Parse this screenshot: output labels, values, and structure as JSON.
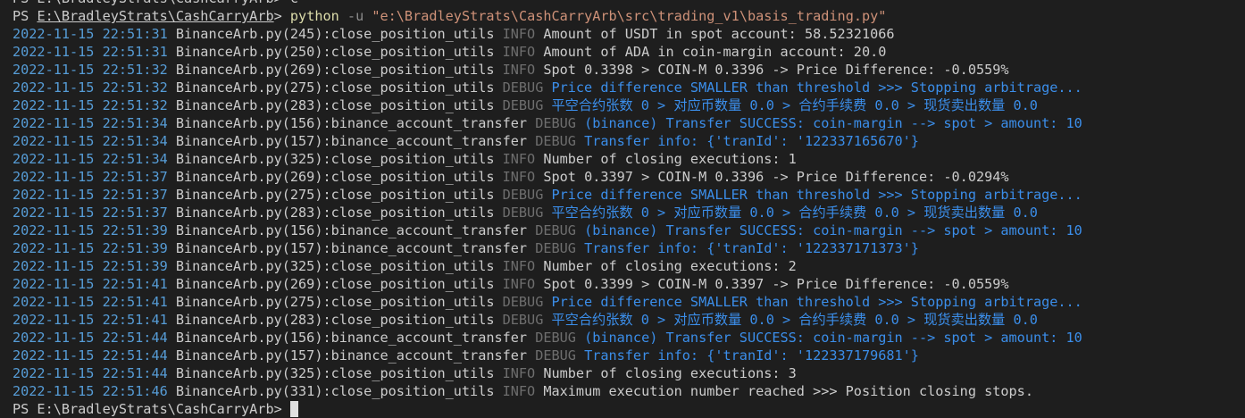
{
  "terminal": {
    "prev_line": "PS E:\\BradleyStrats\\CashCarryArb> c",
    "command": {
      "ps": "PS ",
      "path": "E:\\BradleyStrats\\CashCarryArb",
      "gt": "> ",
      "cmd": "python",
      "flag": " -u ",
      "arg": "\"e:\\BradleyStrats\\CashCarryArb\\src\\trading_v1\\basis_trading.py\""
    },
    "logs": [
      {
        "ts": "2022-11-15 22:51:31",
        "src": " BinanceArb.py(245):close_position_utils ",
        "level": "INFO",
        "msg": " Amount of USDT in spot account: 58.52321066"
      },
      {
        "ts": "2022-11-15 22:51:31",
        "src": " BinanceArb.py(250):close_position_utils ",
        "level": "INFO",
        "msg": " Amount of ADA in coin-margin account: 20.0"
      },
      {
        "ts": "2022-11-15 22:51:32",
        "src": " BinanceArb.py(269):close_position_utils ",
        "level": "INFO",
        "msg": " Spot 0.3398 > COIN-M 0.3396 -> Price Difference: -0.0559%"
      },
      {
        "ts": "2022-11-15 22:51:32",
        "src": " BinanceArb.py(275):close_position_utils ",
        "level": "DEBUG",
        "msg": " Price difference SMALLER than threshold >>> Stopping arbitrage..."
      },
      {
        "ts": "2022-11-15 22:51:32",
        "src": " BinanceArb.py(283):close_position_utils ",
        "level": "DEBUG",
        "msg": " 平空合约张数 0 > 对应币数量 0.0 > 合约手续费 0.0 > 现货卖出数量 0.0"
      },
      {
        "ts": "2022-11-15 22:51:34",
        "src": " BinanceArb.py(156):binance_account_transfer ",
        "level": "DEBUG",
        "msg": " (binance) Transfer SUCCESS: coin-margin --> spot > amount: 10"
      },
      {
        "ts": "2022-11-15 22:51:34",
        "src": " BinanceArb.py(157):binance_account_transfer ",
        "level": "DEBUG",
        "msg": " Transfer info: {'tranId': '122337165670'}"
      },
      {
        "ts": "2022-11-15 22:51:34",
        "src": " BinanceArb.py(325):close_position_utils ",
        "level": "INFO",
        "msg": " Number of closing executions: 1"
      },
      {
        "ts": "2022-11-15 22:51:37",
        "src": " BinanceArb.py(269):close_position_utils ",
        "level": "INFO",
        "msg": " Spot 0.3397 > COIN-M 0.3396 -> Price Difference: -0.0294%"
      },
      {
        "ts": "2022-11-15 22:51:37",
        "src": " BinanceArb.py(275):close_position_utils ",
        "level": "DEBUG",
        "msg": " Price difference SMALLER than threshold >>> Stopping arbitrage..."
      },
      {
        "ts": "2022-11-15 22:51:37",
        "src": " BinanceArb.py(283):close_position_utils ",
        "level": "DEBUG",
        "msg": " 平空合约张数 0 > 对应币数量 0.0 > 合约手续费 0.0 > 现货卖出数量 0.0"
      },
      {
        "ts": "2022-11-15 22:51:39",
        "src": " BinanceArb.py(156):binance_account_transfer ",
        "level": "DEBUG",
        "msg": " (binance) Transfer SUCCESS: coin-margin --> spot > amount: 10"
      },
      {
        "ts": "2022-11-15 22:51:39",
        "src": " BinanceArb.py(157):binance_account_transfer ",
        "level": "DEBUG",
        "msg": " Transfer info: {'tranId': '122337171373'}"
      },
      {
        "ts": "2022-11-15 22:51:39",
        "src": " BinanceArb.py(325):close_position_utils ",
        "level": "INFO",
        "msg": " Number of closing executions: 2"
      },
      {
        "ts": "2022-11-15 22:51:41",
        "src": " BinanceArb.py(269):close_position_utils ",
        "level": "INFO",
        "msg": " Spot 0.3399 > COIN-M 0.3397 -> Price Difference: -0.0559%"
      },
      {
        "ts": "2022-11-15 22:51:41",
        "src": " BinanceArb.py(275):close_position_utils ",
        "level": "DEBUG",
        "msg": " Price difference SMALLER than threshold >>> Stopping arbitrage..."
      },
      {
        "ts": "2022-11-15 22:51:41",
        "src": " BinanceArb.py(283):close_position_utils ",
        "level": "DEBUG",
        "msg": " 平空合约张数 0 > 对应币数量 0.0 > 合约手续费 0.0 > 现货卖出数量 0.0"
      },
      {
        "ts": "2022-11-15 22:51:44",
        "src": " BinanceArb.py(156):binance_account_transfer ",
        "level": "DEBUG",
        "msg": " (binance) Transfer SUCCESS: coin-margin --> spot > amount: 10"
      },
      {
        "ts": "2022-11-15 22:51:44",
        "src": " BinanceArb.py(157):binance_account_transfer ",
        "level": "DEBUG",
        "msg": " Transfer info: {'tranId': '122337179681'}"
      },
      {
        "ts": "2022-11-15 22:51:44",
        "src": " BinanceArb.py(325):close_position_utils ",
        "level": "INFO",
        "msg": " Number of closing executions: 3"
      },
      {
        "ts": "2022-11-15 22:51:46",
        "src": " BinanceArb.py(331):close_position_utils ",
        "level": "INFO",
        "msg": " Maximum execution number reached >>> Position closing stops."
      }
    ],
    "final_prompt": "PS E:\\BradleyStrats\\CashCarryArb> "
  }
}
